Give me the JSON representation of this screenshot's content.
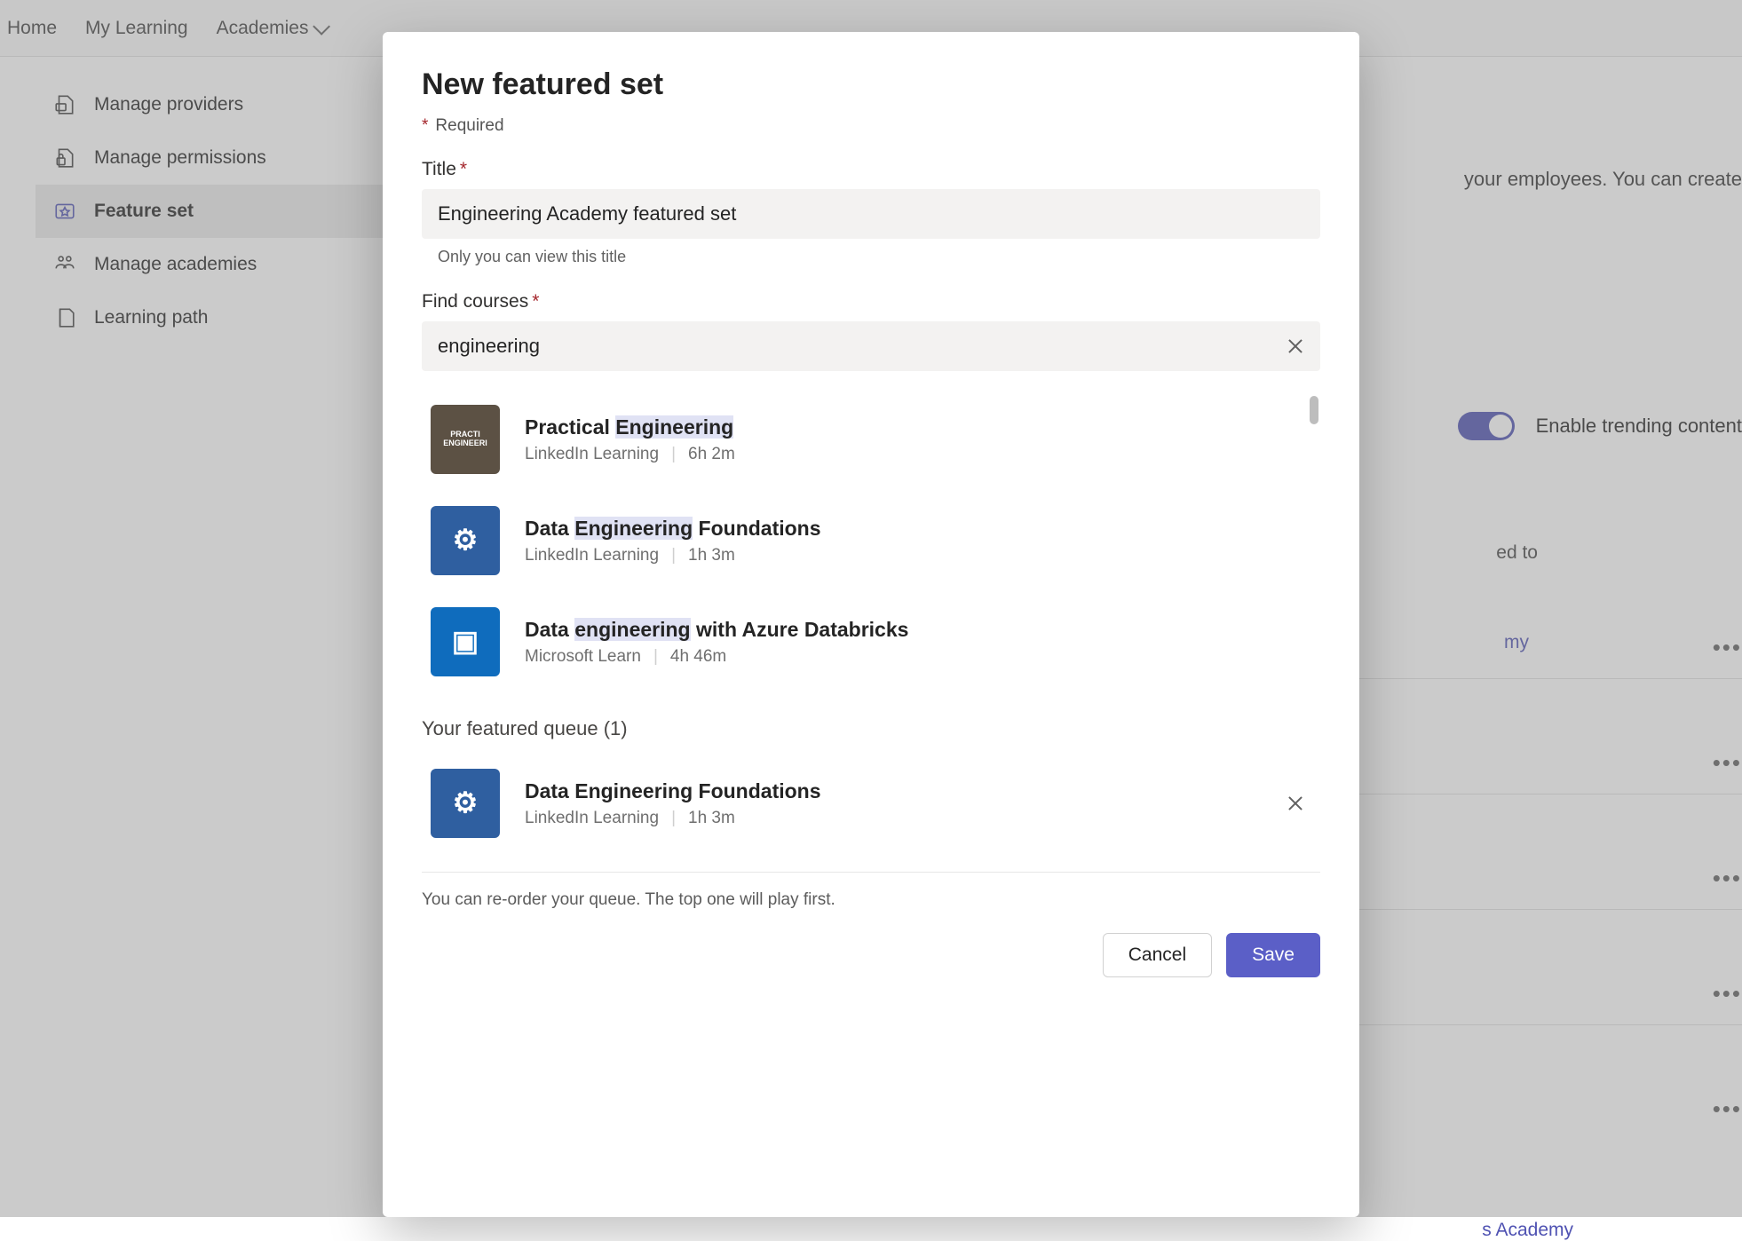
{
  "nav": {
    "home": "Home",
    "my_learning": "My Learning",
    "academies": "Academies"
  },
  "sidebar": {
    "items": [
      {
        "label": "Manage providers"
      },
      {
        "label": "Manage permissions"
      },
      {
        "label": "Feature set"
      },
      {
        "label": "Manage academies"
      },
      {
        "label": "Learning path"
      }
    ]
  },
  "background": {
    "intro_fragment": " your employees. You can create",
    "toggle_label": "Enable trending content",
    "ed_to": "ed to",
    "link_my": "my",
    "link_academy": "s Academy"
  },
  "modal": {
    "title": "New featured set",
    "required_note": "Required",
    "title_field": {
      "label": "Title",
      "value": "Engineering Academy featured set",
      "hint": "Only you can view this title"
    },
    "find_courses": {
      "label": "Find courses",
      "value": "engineering"
    },
    "results": [
      {
        "title_pre": "Practical ",
        "title_hl": "Engineering",
        "title_post": "",
        "source": "LinkedIn Learning",
        "duration": "6h 2m",
        "thumb_color": "#5c5144",
        "thumb_text": "PRACTI ENGINEERI"
      },
      {
        "title_pre": "Data ",
        "title_hl": "Engineering",
        "title_post": " Foundations",
        "source": "LinkedIn Learning",
        "duration": "1h 3m",
        "thumb_color": "#2f5fa0",
        "thumb_text": "⚙"
      },
      {
        "title_pre": "Data ",
        "title_hl": "engineering",
        "title_post": " with Azure Databricks",
        "source": "Microsoft Learn",
        "duration": "4h 46m",
        "thumb_color": "#0f6cbd",
        "thumb_text": "▣"
      }
    ],
    "queue_label": "Your featured queue (1)",
    "queue": [
      {
        "title": "Data Engineering Foundations",
        "source": "LinkedIn Learning",
        "duration": "1h 3m",
        "thumb_color": "#2f5fa0",
        "thumb_text": "⚙"
      }
    ],
    "reorder_note": "You can re-order your queue. The top one will play first.",
    "cancel": "Cancel",
    "save": "Save"
  }
}
